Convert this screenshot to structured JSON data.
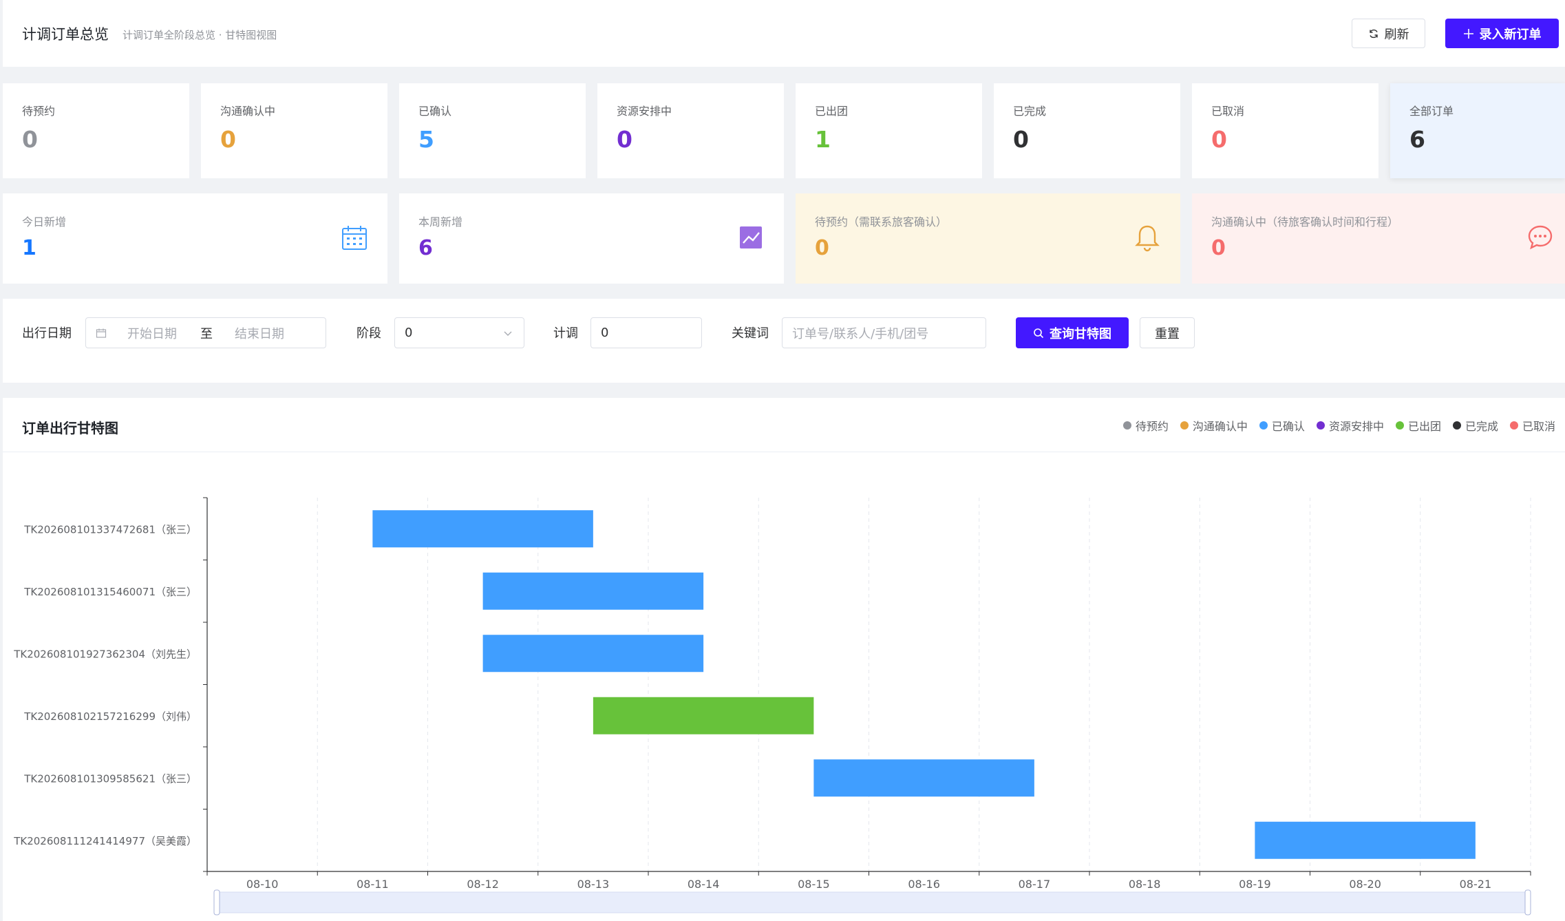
{
  "header": {
    "title": "计调订单总览",
    "subtitle": "计调订单全阶段总览 · 甘特图视图",
    "refresh_label": "刷新",
    "new_order_label": "录入新订单"
  },
  "stats": [
    {
      "label": "待预约",
      "value": "0",
      "color": "#909399"
    },
    {
      "label": "沟通确认中",
      "value": "0",
      "color": "#e6a23c"
    },
    {
      "label": "已确认",
      "value": "5",
      "color": "#409eff"
    },
    {
      "label": "资源安排中",
      "value": "0",
      "color": "#722ed1"
    },
    {
      "label": "已出团",
      "value": "1",
      "color": "#67c23a"
    },
    {
      "label": "已完成",
      "value": "0",
      "color": "#303133"
    },
    {
      "label": "已取消",
      "value": "0",
      "color": "#f56c6c"
    },
    {
      "label": "全部订单",
      "value": "6",
      "color": "#303133"
    }
  ],
  "summary": [
    {
      "label": "今日新增",
      "value": "1",
      "color": "#1677ff",
      "icon": "calendar-icon"
    },
    {
      "label": "本周新增",
      "value": "6",
      "color": "#722ed1",
      "icon": "trend-chart-icon"
    },
    {
      "label": "待预约（需联系旅客确认）",
      "value": "0",
      "color": "#e6a23c",
      "icon": "bell-icon"
    },
    {
      "label": "沟通确认中（待旅客确认时间和行程）",
      "value": "0",
      "color": "#f56c6c",
      "icon": "chat-icon"
    }
  ],
  "filter": {
    "date_label": "出行日期",
    "start_placeholder": "开始日期",
    "range_separator": "至",
    "end_placeholder": "结束日期",
    "stage_label": "阶段",
    "stage_value": "0",
    "planner_label": "计调",
    "planner_value": "0",
    "keyword_label": "关键词",
    "keyword_placeholder": "订单号/联系人/手机/团号",
    "query_label": "查询甘特图",
    "reset_label": "重置"
  },
  "chart_data": {
    "type": "gantt",
    "title": "订单出行甘特图",
    "legend": [
      {
        "label": "待预约",
        "color": "#909399"
      },
      {
        "label": "沟通确认中",
        "color": "#e6a23c"
      },
      {
        "label": "已确认",
        "color": "#409eff"
      },
      {
        "label": "资源安排中",
        "color": "#722ed1"
      },
      {
        "label": "已出团",
        "color": "#67c23a"
      },
      {
        "label": "已完成",
        "color": "#303133"
      },
      {
        "label": "已取消",
        "color": "#f56c6c"
      }
    ],
    "x_ticks": [
      "08-10",
      "08-11",
      "08-12",
      "08-13",
      "08-14",
      "08-15",
      "08-16",
      "08-17",
      "08-18",
      "08-19",
      "08-20",
      "08-21"
    ],
    "x_range": [
      "08-09.5",
      "08-21.5"
    ],
    "rows": [
      {
        "label": "TK202608101337472681（张三）",
        "start": "08-11",
        "end": "08-13",
        "status": "已确认"
      },
      {
        "label": "TK202608101315460071（张三）",
        "start": "08-12",
        "end": "08-14",
        "status": "已确认"
      },
      {
        "label": "TK202608101927362304（刘先生）",
        "start": "08-12",
        "end": "08-14",
        "status": "已确认"
      },
      {
        "label": "TK202608102157216299（刘伟）",
        "start": "08-13",
        "end": "08-15",
        "status": "已出团"
      },
      {
        "label": "TK202608101309585621（张三）",
        "start": "08-15",
        "end": "08-17",
        "status": "已确认"
      },
      {
        "label": "TK202608111241414977（吴美霞）",
        "start": "08-19",
        "end": "08-21",
        "status": "已确认"
      }
    ]
  }
}
